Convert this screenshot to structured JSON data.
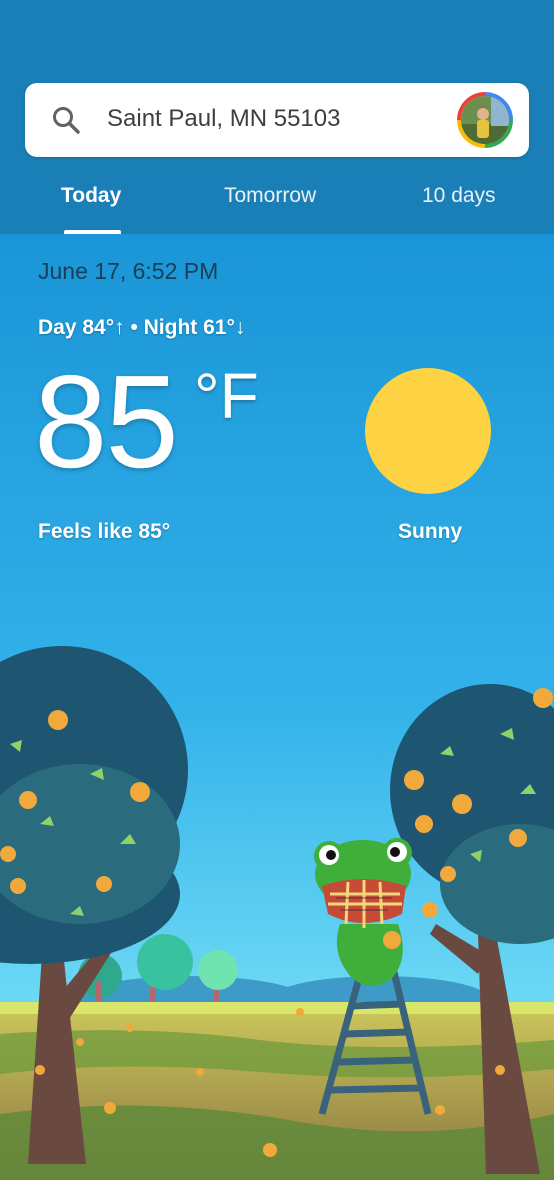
{
  "search": {
    "location": "Saint Paul, MN 55103"
  },
  "tabs": [
    {
      "label": "Today",
      "selected": true
    },
    {
      "label": "Tomorrow",
      "selected": false
    },
    {
      "label": "10 days",
      "selected": false
    }
  ],
  "weather": {
    "datetime": "June 17, 6:52 PM",
    "day_night": "Day 84°↑ • Night 61°↓",
    "temperature": "85",
    "unit": "°F",
    "feels_like": "Feels like 85°",
    "condition": "Sunny",
    "condition_icon": "sun-icon"
  },
  "colors": {
    "header": "#1a7fb6",
    "sky_top": "#1a95d7",
    "sun": "#fdd343",
    "frog": "#3fae3a"
  }
}
